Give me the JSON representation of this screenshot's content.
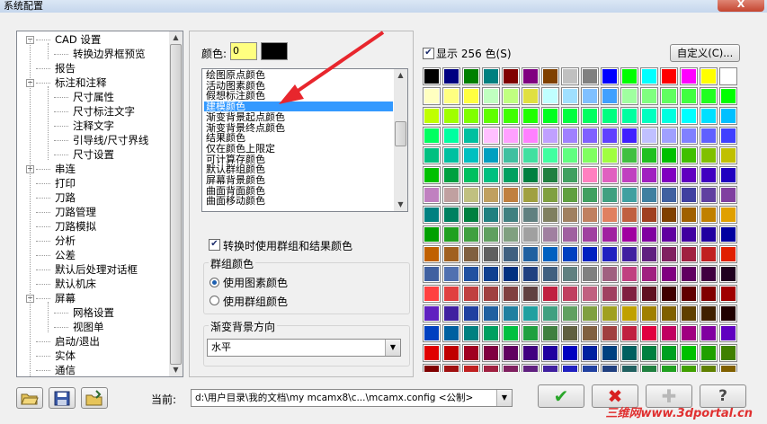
{
  "window": {
    "title": "系统配置",
    "close": "X"
  },
  "tree": {
    "items": [
      {
        "label": "CAD 设置",
        "level": 0,
        "expand": "−"
      },
      {
        "label": "转换边界框预览",
        "level": 1
      },
      {
        "label": "报告",
        "level": 0
      },
      {
        "label": "标注和注释",
        "level": 0,
        "expand": "−"
      },
      {
        "label": "尺寸属性",
        "level": 1
      },
      {
        "label": "尺寸标注文字",
        "level": 1
      },
      {
        "label": "注释文字",
        "level": 1
      },
      {
        "label": "引导线/尺寸界线",
        "level": 1
      },
      {
        "label": "尺寸设置",
        "level": 1
      },
      {
        "label": "串连",
        "level": 0,
        "expand": "+"
      },
      {
        "label": "打印",
        "level": 0
      },
      {
        "label": "刀路",
        "level": 0
      },
      {
        "label": "刀路管理",
        "level": 0
      },
      {
        "label": "刀路模拟",
        "level": 0
      },
      {
        "label": "分析",
        "level": 0
      },
      {
        "label": "公差",
        "level": 0
      },
      {
        "label": "默认后处理对话框",
        "level": 0
      },
      {
        "label": "默认机床",
        "level": 0
      },
      {
        "label": "屏幕",
        "level": 0,
        "expand": "−"
      },
      {
        "label": "网格设置",
        "level": 1
      },
      {
        "label": "视图单",
        "level": 1
      },
      {
        "label": "启动/退出",
        "level": 0
      },
      {
        "label": "实体",
        "level": 0
      },
      {
        "label": "通信",
        "level": 0
      }
    ]
  },
  "color_settings": {
    "color_label": "颜色:",
    "color_value": "0",
    "color_swatch": "#000000",
    "items": [
      "绘图原点颜色",
      "活动图素颜色",
      "假想标注颜色",
      "建模颜色",
      "渐变背景起点颜色",
      "渐变背景终点颜色",
      "结果颜色",
      "仅在颜色上限定",
      "可计算存颜色",
      "默认群组颜色",
      "屏幕背景颜色",
      "曲面背面颜色",
      "曲面移动颜色"
    ],
    "selected_index": 3,
    "convert_check_label": "转换时使用群组和结果颜色",
    "group_color_title": "群组颜色",
    "radio_entity": "使用图素颜色",
    "radio_group": "使用群组颜色",
    "gradient_title": "渐变背景方向",
    "gradient_value": "水平"
  },
  "palette": {
    "show_label": "显示 256 色(S)",
    "custom_button": "自定义(C)..."
  },
  "footer": {
    "current_label": "当前:",
    "config_path": "d:\\用户目录\\我的文档\\my mcamx8\\c...\\mcamx.config <公制>",
    "ok_icon": "✔",
    "cancel_icon": "✖",
    "add_icon": "✚",
    "help_icon": "?"
  },
  "watermark": "三维网www.3dportal.cn",
  "colors": {
    "accent": "#3399ff",
    "color_field": "#ffff80",
    "arrow": "#e8262d"
  }
}
